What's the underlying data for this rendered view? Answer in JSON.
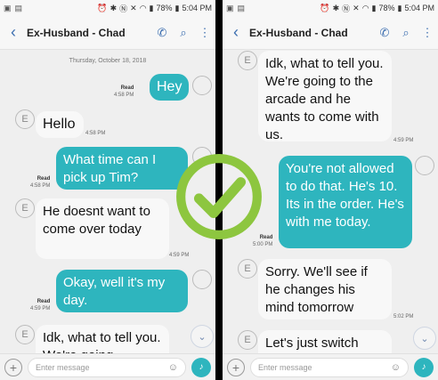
{
  "status": {
    "battery": "78%",
    "time": "5:04 PM"
  },
  "header": {
    "title": "Ex-Husband - Chad"
  },
  "composer": {
    "placeholder": "Enter message"
  },
  "left": {
    "date": "Thursday, October 18, 2018",
    "messages": [
      {
        "dir": "out",
        "text": "Hey",
        "read": "Read",
        "time": "4:58 PM"
      },
      {
        "dir": "in",
        "text": "Hello",
        "time": "4:58 PM"
      },
      {
        "dir": "out",
        "text": "What time can I pick up Tim?",
        "read": "Read",
        "time": "4:58 PM"
      },
      {
        "dir": "in",
        "text": "He doesnt want to come over today",
        "time": "4:59 PM"
      },
      {
        "dir": "out",
        "text": "Okay, well it's my day.",
        "read": "Read",
        "time": "4:59 PM"
      },
      {
        "dir": "in",
        "text": "Idk, what to tell you. We're going"
      }
    ]
  },
  "right": {
    "messages": [
      {
        "dir": "in",
        "text": "Idk, what to tell you. We're going to the arcade and he wants to come with us.",
        "time": "4:59 PM"
      },
      {
        "dir": "out",
        "text": "You're not allowed to do that. He's 10. Its in the order. He's with me today.",
        "read": "Read",
        "time": "5:00 PM"
      },
      {
        "dir": "in",
        "text": "Sorry. We'll see if he changes his mind tomorrow",
        "time": "5:02 PM"
      },
      {
        "dir": "in",
        "text": "Let's just switch"
      }
    ]
  },
  "contact_initial": "E",
  "colors": {
    "outgoing_bubble": "#2eb5be",
    "incoming_bubble": "#f8f8f8",
    "accent": "#3d6fb0",
    "check_green": "#8dc63f"
  },
  "icons": [
    "back-arrow-icon",
    "phone-icon",
    "search-icon",
    "more-vert-icon",
    "add-icon",
    "sticker-icon",
    "voice-icon",
    "chevron-down-icon",
    "checkmark-icon"
  ]
}
